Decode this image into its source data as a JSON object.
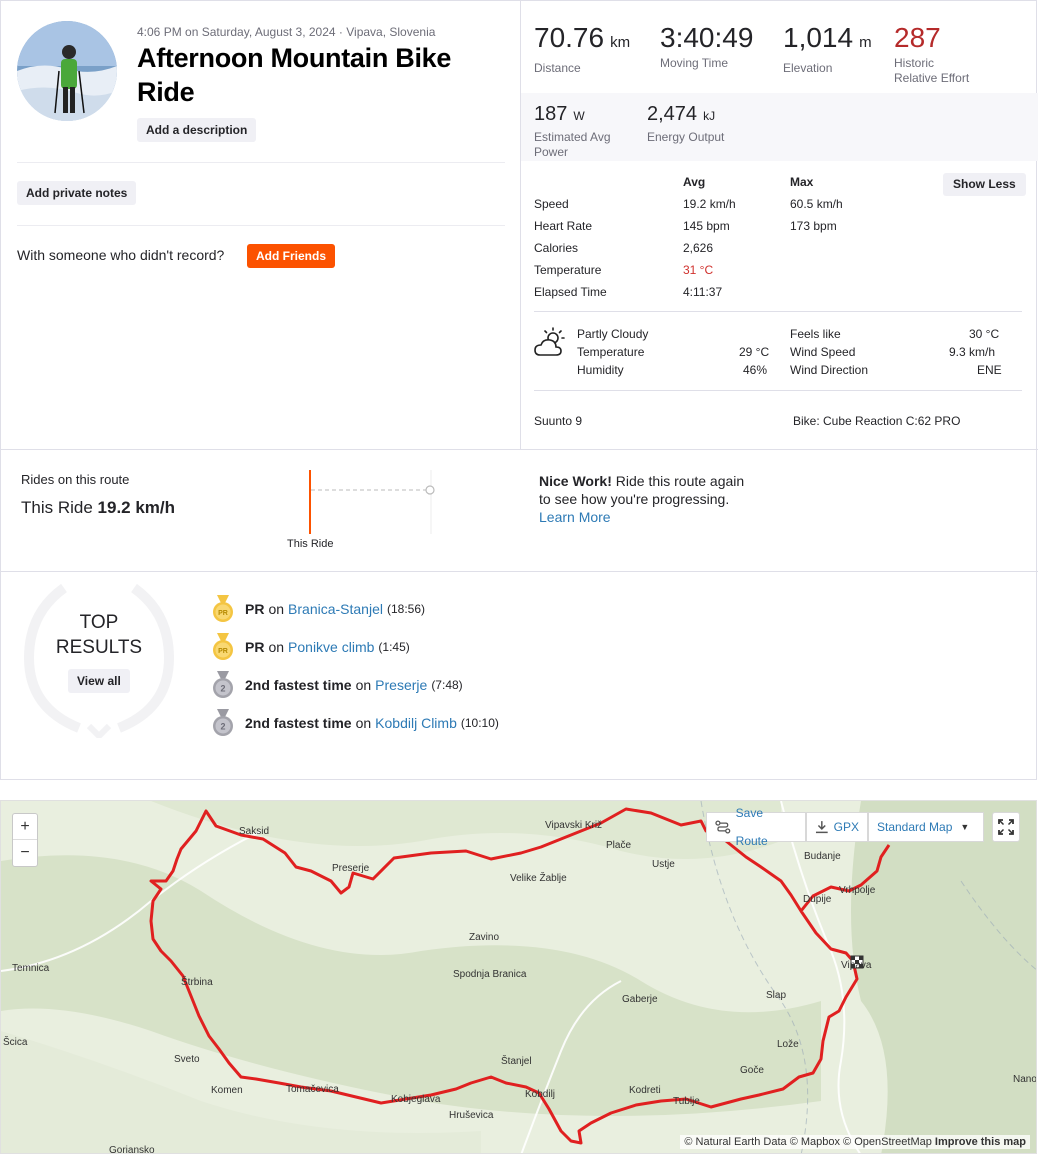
{
  "header": {
    "datetime": "4:06 PM on Saturday, August 3, 2024 · Vipava, Slovenia",
    "title": "Afternoon Mountain Bike Ride",
    "add_description": "Add a description",
    "add_private_notes": "Add private notes",
    "with_someone": "With someone who didn't record?",
    "add_friends": "Add Friends"
  },
  "stats": {
    "distance": {
      "value": "70.76",
      "unit": "km",
      "label": "Distance"
    },
    "moving_time": {
      "value": "3:40:49",
      "label": "Moving Time"
    },
    "elevation": {
      "value": "1,014",
      "unit": "m",
      "label": "Elevation"
    },
    "effort": {
      "value": "287",
      "label1": "Historic",
      "label2": "Relative Effort"
    },
    "power": {
      "value": "187",
      "unit": "W",
      "label1": "Estimated Avg",
      "label2": "Power"
    },
    "energy": {
      "value": "2,474",
      "unit": "kJ",
      "label": "Energy Output"
    }
  },
  "details": {
    "col_avg": "Avg",
    "col_max": "Max",
    "show_less": "Show Less",
    "rows": [
      {
        "label": "Speed",
        "avg": "19.2 km/h",
        "max": "60.5 km/h"
      },
      {
        "label": "Heart Rate",
        "avg": "145 bpm",
        "max": "173 bpm"
      },
      {
        "label": "Calories",
        "avg": "2,626",
        "max": ""
      },
      {
        "label": "Temperature",
        "avg": "31 °C",
        "max": ""
      },
      {
        "label": "Elapsed Time",
        "avg": "4:11:37",
        "max": ""
      }
    ]
  },
  "weather": {
    "condition": "Partly Cloudy",
    "temperature_label": "Temperature",
    "temperature": "29 °C",
    "humidity_label": "Humidity",
    "humidity": "46%",
    "feels_like_label": "Feels like",
    "feels_like": "30 °C",
    "wind_speed_label": "Wind Speed",
    "wind_speed": "9.3 km/h",
    "wind_dir_label": "Wind Direction",
    "wind_dir": "ENE"
  },
  "gear": {
    "device": "Suunto 9",
    "bike": "Bike: Cube Reaction C:62 PRO"
  },
  "route": {
    "heading": "Rides on this route",
    "this_ride_prefix": "This Ride",
    "this_ride_value": "19.2 km/h",
    "chart_label": "This Ride",
    "nice_work": "Nice Work!",
    "message": "Ride this route again to see how you're progressing.",
    "learn_more": "Learn More"
  },
  "top_results": {
    "title1": "TOP",
    "title2": "RESULTS",
    "view_all": "View all",
    "items": [
      {
        "rank": "PR",
        "on": "on",
        "segment": "Branica-Stanjel",
        "time": "(18:56)",
        "medal": "gold"
      },
      {
        "rank": "PR",
        "on": "on",
        "segment": "Ponikve climb",
        "time": "(1:45)",
        "medal": "gold"
      },
      {
        "rank": "2nd fastest time",
        "on": "on",
        "segment": "Preserje",
        "time": "(7:48)",
        "medal": "silver"
      },
      {
        "rank": "2nd fastest time",
        "on": "on",
        "segment": "Kobdilj Climb",
        "time": "(10:10)",
        "medal": "silver"
      }
    ]
  },
  "map": {
    "zoom_in": "+",
    "zoom_out": "−",
    "save_route": "Save Route",
    "gpx": "GPX",
    "map_type": "Standard Map",
    "attribution": "© Natural Earth Data © Mapbox © OpenStreetMap",
    "improve": "Improve this map",
    "places": [
      "Saksid",
      "Vipavski Križ",
      "Plače",
      "Ustje",
      "Budanje",
      "Preserje",
      "Velike Žablje",
      "Vrhpolje",
      "Dupije",
      "Zavino",
      "Vipava",
      "Temnica",
      "Spodnja Branica",
      "Gaberje",
      "Slap",
      "Štrbina",
      "Šcica",
      "Sveto",
      "Lože",
      "Goče",
      "Komen",
      "Štanjel",
      "Tomačevica",
      "Kobjeglava",
      "Kobdilj",
      "Kodreti",
      "Hruševica",
      "Tublje",
      "Nanos",
      "Gorjansko"
    ],
    "route_color": "#e02020"
  }
}
